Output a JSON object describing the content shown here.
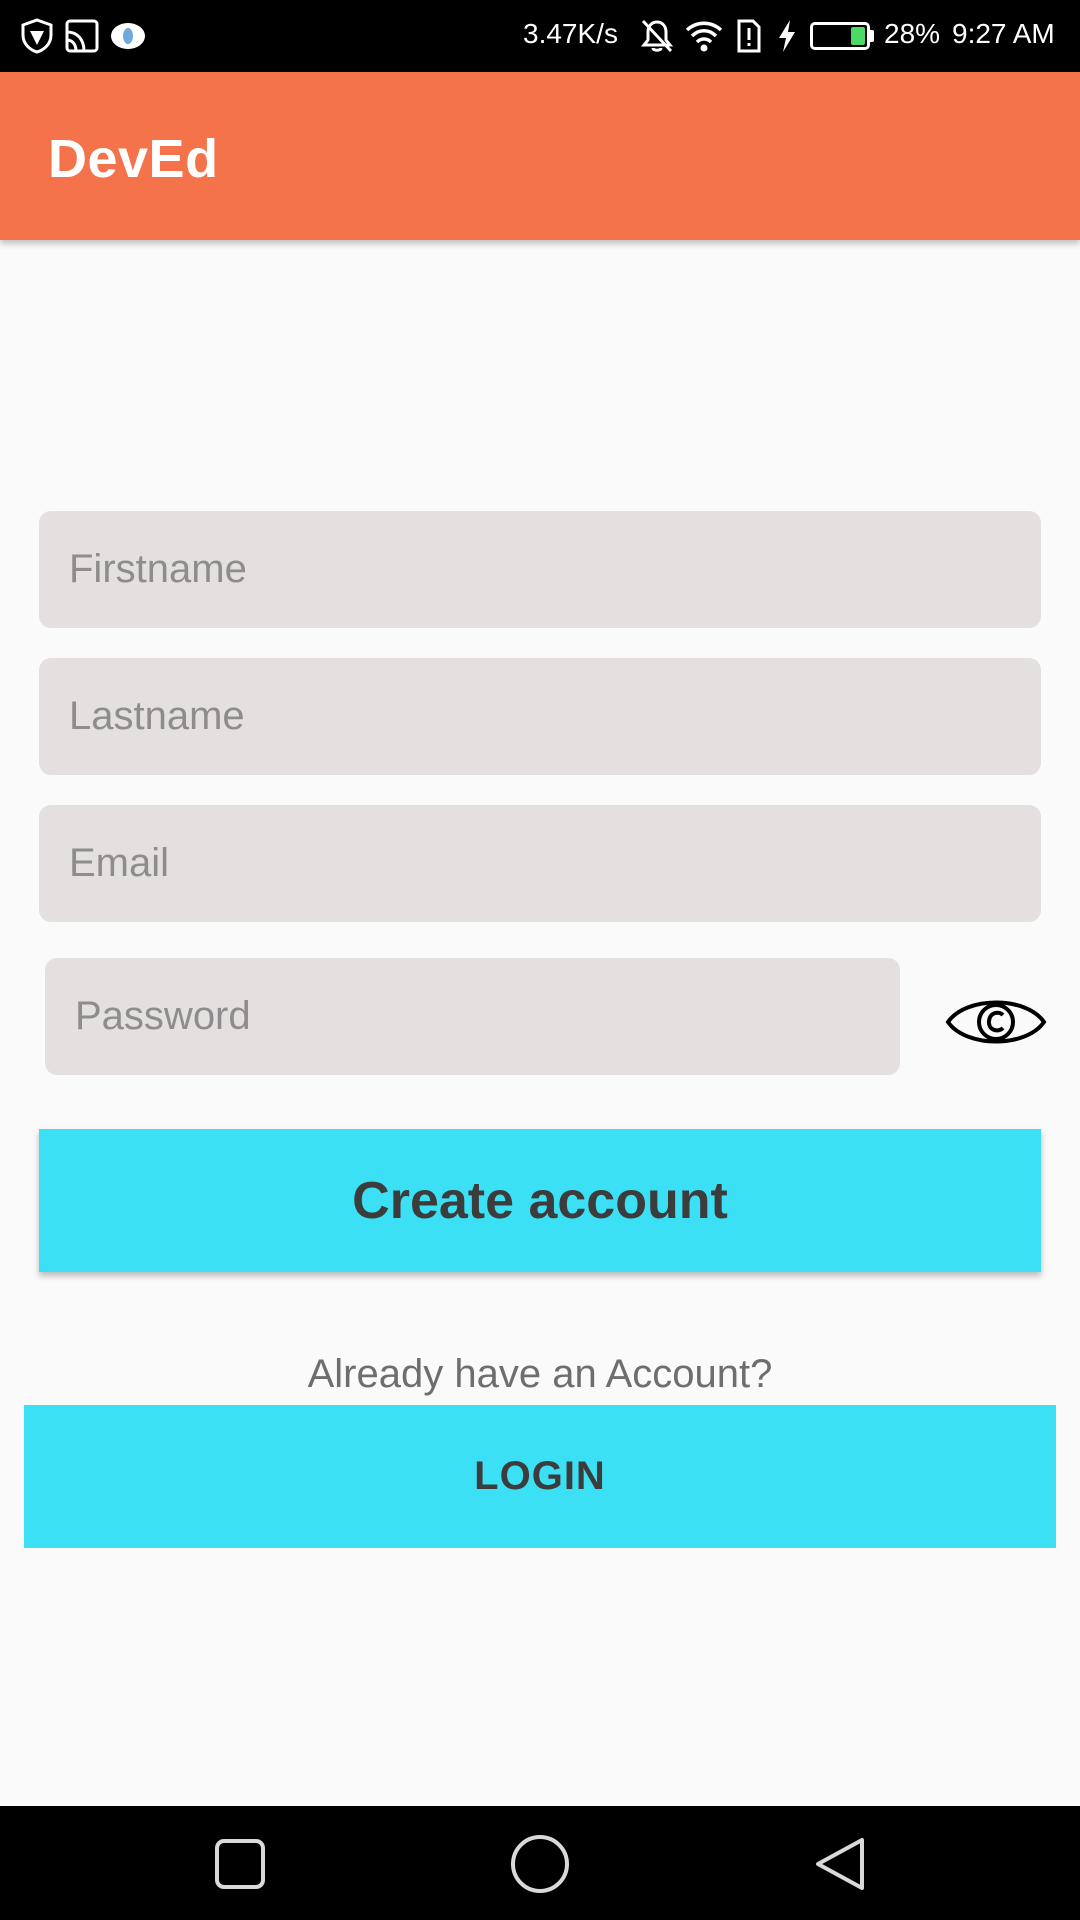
{
  "status_bar": {
    "net_speed": "3.47K/s",
    "battery_percent": "28%",
    "battery_level": 0.28,
    "battery_fill_color": "#4cd964",
    "time": "9:27 AM",
    "icons": [
      "shield-icon",
      "cast-icon",
      "cloud-icon",
      "bell-off-icon",
      "wifi-icon",
      "sim-alert-icon",
      "charging-icon",
      "battery-icon"
    ]
  },
  "app_bar": {
    "title": "DevEd",
    "color": "#f5734b"
  },
  "form": {
    "firstname_placeholder": "Firstname",
    "lastname_placeholder": "Lastname",
    "email_placeholder": "Email",
    "password_placeholder": "Password",
    "password_toggle_icon": "eye-icon",
    "create_account_label": "Create account",
    "accent_color": "#3ce0f5"
  },
  "login": {
    "prompt": "Already have an Account?",
    "login_label": "LOGIN"
  },
  "nav_bar": {
    "icons": [
      "recents-square-icon",
      "home-circle-icon",
      "back-triangle-icon"
    ]
  }
}
